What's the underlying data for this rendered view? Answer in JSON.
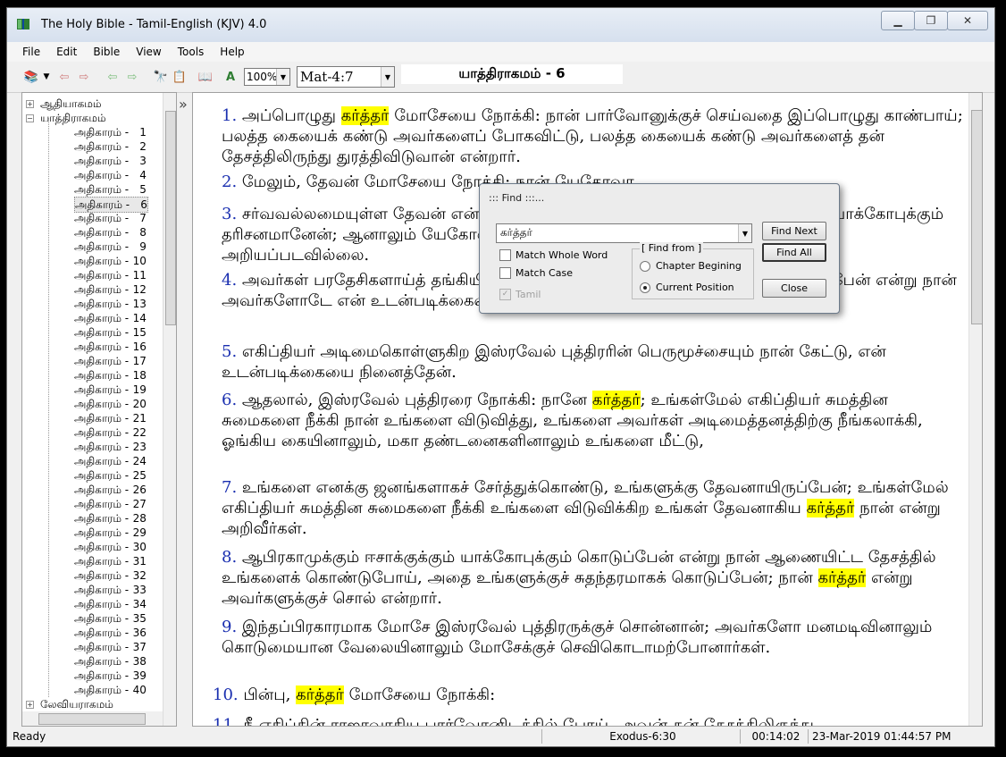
{
  "window": {
    "title": "The Holy Bible - Tamil-English (KJV) 4.0"
  },
  "menu": [
    "File",
    "Edit",
    "Bible",
    "View",
    "Tools",
    "Help"
  ],
  "toolbar": {
    "zoom": "100%",
    "reference": "Mat-4:7",
    "chapter_title": "யாத்திராகமம்  -  6"
  },
  "tree": {
    "top_items": [
      "ஆதியாகமம்",
      "யாத்திராகமம்"
    ],
    "chapter_label": "அதிகாரம்",
    "chapters": [
      "1",
      "2",
      "3",
      "4",
      "5",
      "6",
      "7",
      "8",
      "9",
      "10",
      "11",
      "12",
      "13",
      "14",
      "15",
      "16",
      "17",
      "18",
      "19",
      "20",
      "21",
      "22",
      "23",
      "24",
      "25",
      "26",
      "27",
      "28",
      "29",
      "30",
      "31",
      "32",
      "33",
      "34",
      "35",
      "36",
      "37",
      "38",
      "39",
      "40"
    ],
    "selected_chapter": "6",
    "next_book": "லேவியராகமம்"
  },
  "verses": [
    {
      "num": "1.",
      "parts": [
        {
          "t": "அப்பொழுது "
        },
        {
          "t": "கர்த்தர்",
          "hl": true
        },
        {
          "t": " மோசேயை நோக்கி: நான் பார்வோனுக்குச் செய்வதை இப்பொழுது காண்பாய்; பலத்த கையைக் கண்டு அவர்களைப் போகவிட்டு, பலத்த கையைக் கண்டு அவர்களைத் தன் தேசத்திலிருந்து துரத்திவிடுவான் என்றார்."
        }
      ]
    },
    {
      "num": "2.",
      "parts": [
        {
          "t": "மேலும், தேவன் மோசேயை நோக்கி: நான் யேகோவா."
        }
      ]
    },
    {
      "num": "3.",
      "parts": [
        {
          "t": "சர்வவல்லமையுள்ள தேவன் என்னும் நாமத்தினால் ஆபிரகாமுக்கும் ஈசாக்குக்கும் யாக்கோபுக்கும் தரிசனமானேன்; ஆனாலும் யேகோவா என்னும் என் நாமத்தினால் நான் அவர்களுக்கு அறியப்படவில்லை."
        }
      ]
    },
    {
      "num": "4.",
      "parts": [
        {
          "t": "அவர்கள் பரதேசிகளாய்த் தங்கியிருந்த கானான் தேசத்தை அவர்களுக்குக் கொடுப்பேன் என்று நான் அவர்களோடே என் உடன்படிக்கையை ஏற்படுத்தியிருக்கிறேன்."
        }
      ]
    },
    {
      "num": "5.",
      "parts": [
        {
          "t": "எகிப்தியர் அடிமைகொள்ளுகிற இஸ்ரவேல் புத்திரரின் பெருமூச்சையும் நான் கேட்டு, என் உடன்படிக்கையை நினைத்தேன்."
        }
      ]
    },
    {
      "num": "6.",
      "parts": [
        {
          "t": "ஆதலால், இஸ்ரவேல் புத்திரரை நோக்கி: நானே "
        },
        {
          "t": "கர்த்தர்",
          "hl": true
        },
        {
          "t": "; உங்கள்மேல் எகிப்தியர் சுமத்தின சுமைகளை நீக்கி நான் உங்களை விடுவித்து, உங்களை அவர்கள் அடிமைத்தனத்திற்கு நீங்கலாக்கி, ஓங்கிய கையினாலும், மகா தண்டனைகளினாலும் உங்களை மீட்டு,"
        }
      ]
    },
    {
      "num": "7.",
      "parts": [
        {
          "t": "உங்களை எனக்கு ஜனங்களாகச் சேர்த்துக்கொண்டு, உங்களுக்கு தேவனாயிருப்பேன்; உங்கள்மேல் எகிப்தியர் சுமத்தின சுமைகளை நீக்கி உங்களை விடுவிக்கிற உங்கள் தேவனாகிய "
        },
        {
          "t": "கர்த்தர்",
          "hl": true
        },
        {
          "t": " நான் என்று அறிவீர்கள்."
        }
      ]
    },
    {
      "num": "8.",
      "parts": [
        {
          "t": "ஆபிரகாமுக்கும் ஈசாக்குக்கும் யாக்கோபுக்கும் கொடுப்பேன் என்று நான் ஆணையிட்ட தேசத்தில் உங்களைக் கொண்டுபோய், அதை உங்களுக்குச் சுதந்தரமாகக் கொடுப்பேன்; நான் "
        },
        {
          "t": "கர்த்தர்",
          "hl": true
        },
        {
          "t": " என்று அவர்களுக்குச் சொல் என்றார்."
        }
      ]
    },
    {
      "num": "9.",
      "parts": [
        {
          "t": "இந்தப்பிரகாரமாக மோசே இஸ்ரவேல் புத்திரருக்குச் சொன்னான்; அவர்களோ மனமடிவினாலும் கொடுமையான வேலையினாலும் மோசேக்குச் செவிகொடாமற்போனார்கள்."
        }
      ]
    },
    {
      "num": "10.",
      "parts": [
        {
          "t": "பின்பு, "
        },
        {
          "t": "கர்த்தர்",
          "hl": true
        },
        {
          "t": " மோசேயை நோக்கி:"
        }
      ]
    },
    {
      "num": "11.",
      "parts": [
        {
          "t": "நீ எகிப்தின் ராஜாவாகிய பார்வோனிடத்தில் போய், அவன் தன் தேசத்திலிருந்து"
        }
      ]
    }
  ],
  "find_dialog": {
    "title": "::: Find :::...",
    "search_value": "கர்த்தர்",
    "find_next": "Find Next",
    "find_all": "Find All",
    "close": "Close",
    "match_whole_word": "Match Whole Word",
    "match_case": "Match Case",
    "tamil": "Tamil",
    "find_from_label": "[ Find from ]",
    "chapter_beginning": "Chapter Begining",
    "current_position": "Current Position"
  },
  "status": {
    "ready": "Ready",
    "position": "Exodus-6:30",
    "elapsed": "00:14:02",
    "datetime": "23-Mar-2019 01:44:57 PM"
  }
}
